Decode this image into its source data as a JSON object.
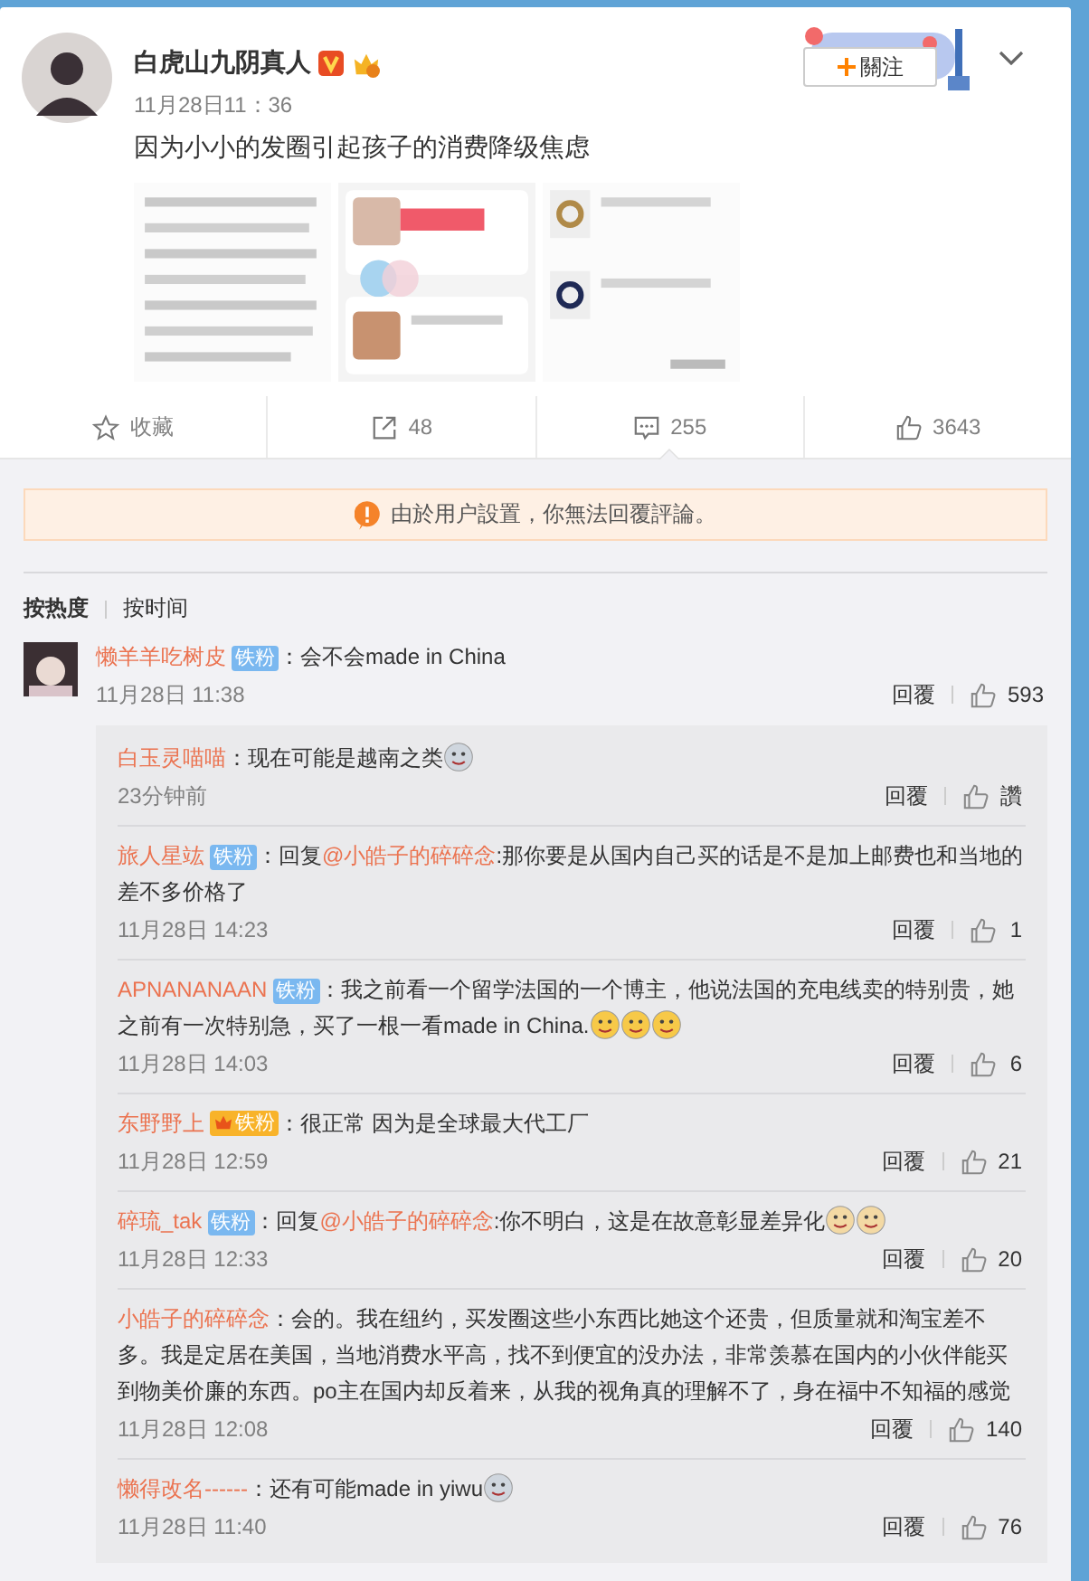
{
  "post": {
    "author": "白虎山九阴真人",
    "verified": true,
    "member_badge": true,
    "time": "11月28日11：36",
    "follow_label": "關注",
    "text": "因为小小的发圈引起孩子的消费降级焦虑"
  },
  "actions": [
    {
      "kind": "favorite",
      "label": "收藏",
      "selected": false
    },
    {
      "kind": "repost",
      "label": "48",
      "selected": false
    },
    {
      "kind": "comment",
      "label": "255",
      "selected": true
    },
    {
      "kind": "like",
      "label": "3643",
      "selected": false
    }
  ],
  "notice": "由於用户設置，你無法回覆評論。",
  "sort_tabs": [
    {
      "label": "按热度",
      "selected": true
    },
    {
      "label": "按时间",
      "selected": false
    }
  ],
  "comment": {
    "author": "懒羊羊吃树皮",
    "badge": {
      "kind": "fan",
      "label": "铁粉"
    },
    "text": "：会不会made in China",
    "time": "11月28日 11:38",
    "reply_label": "回覆",
    "likes": "593",
    "replies": [
      {
        "author": "白玉灵喵喵",
        "text": "：现在可能是越南之类",
        "emojis": [
          {
            "kind": "shock"
          }
        ],
        "time": "23分钟前",
        "reply_label": "回覆",
        "likes": "讚"
      },
      {
        "author": "旅人星竑",
        "badge": {
          "kind": "fan",
          "label": "铁粉"
        },
        "reply_prefix": "：回复",
        "mention": "@小皓子的碎碎念",
        "text": ":那你要是从国内自己买的话是不是加上邮费也和当地的差不多价格了",
        "time": "11月28日 14:23",
        "reply_label": "回覆",
        "likes": "1"
      },
      {
        "author": "APNANANAAN",
        "badge": {
          "kind": "fan",
          "label": "铁粉"
        },
        "text": "：我之前看一个留学法国的一个博主，他说法国的充电线卖的特别贵，她之前有一次特别急，买了一根一看made in China.",
        "emojis": [
          {
            "kind": "tears"
          },
          {
            "kind": "tears"
          },
          {
            "kind": "tears"
          }
        ],
        "time": "11月28日 14:03",
        "reply_label": "回覆",
        "likes": "6"
      },
      {
        "author": "东野野上",
        "badge": {
          "kind": "gold",
          "label": "铁粉"
        },
        "text": "：很正常 因为是全球最大代工厂",
        "time": "11月28日 12:59",
        "reply_label": "回覆",
        "likes": "21"
      },
      {
        "author": "碎琉_tak",
        "badge": {
          "kind": "fan",
          "label": "铁粉"
        },
        "reply_prefix": "：回复",
        "mention": "@小皓子的碎碎念",
        "text": ":你不明白，这是在故意彰显差异化",
        "emojis": [
          {
            "kind": "dog"
          },
          {
            "kind": "dog"
          }
        ],
        "time": "11月28日 12:33",
        "reply_label": "回覆",
        "likes": "20"
      },
      {
        "author": "小皓子的碎碎念",
        "text": "：会的。我在纽约，买发圈这些小东西比她这个还贵，但质量就和淘宝差不多。我是定居在美国，当地消费水平高，找不到便宜的没办法，非常羡慕在国内的小伙伴能买到物美价廉的东西。po主在国内却反着来，从我的视角真的理解不了，身在福中不知福的感觉",
        "time": "11月28日 12:08",
        "reply_label": "回覆",
        "likes": "140"
      },
      {
        "author": "懒得改名------",
        "text": "：还有可能made in yiwu",
        "emojis": [
          {
            "kind": "shock"
          }
        ],
        "time": "11月28日 11:40",
        "reply_label": "回覆",
        "likes": "76"
      }
    ]
  }
}
